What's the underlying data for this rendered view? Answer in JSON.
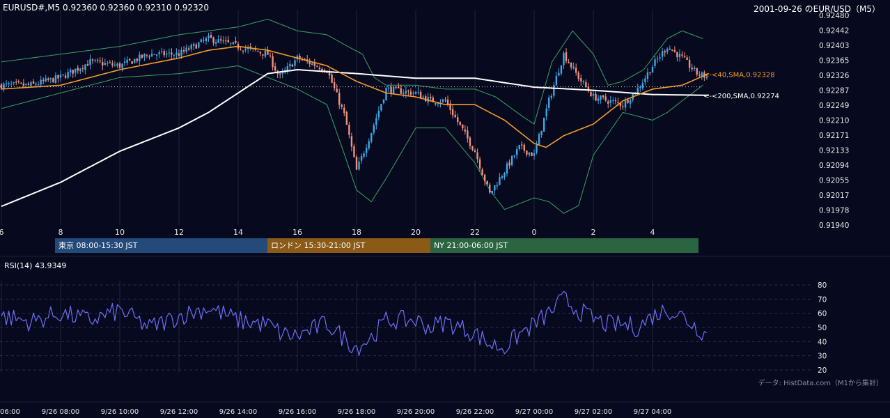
{
  "header": {
    "ohlc_text": "EURUSD#,M5 0.92360 0.92360 0.92310 0.92320",
    "title_date": "2001-09-26 のEUR/USD（M5）"
  },
  "sessions": [
    {
      "label": "東京 08:00-15:30 JST",
      "color": "#244a7a"
    },
    {
      "label": "ロンドン 15:30-21:00 JST",
      "color": "#8a5a16"
    },
    {
      "label": "NY 21:00-06:00 JST",
      "color": "#2a6440"
    }
  ],
  "rsi_panel": {
    "label": "RSI(14) 43.9349",
    "source_note": "データ: HistData.com（M1から集計）"
  },
  "colors": {
    "background": "#070a1f",
    "candle_up": "#3fa7e5",
    "candle_down": "#f2917b",
    "bollinger": "#3aa35f",
    "sma40": "#f39a2a",
    "sma200": "#ffffff",
    "rsi": "#6f6ff5",
    "grid": "#1f2438"
  },
  "chart_data": [
    {
      "type": "candlestick",
      "title": "EURUSD#,M5",
      "y_ticks": [
        "0.92480",
        "0.92442",
        "0.92403",
        "0.92365",
        "0.92326",
        "0.92287",
        "0.92249",
        "0.92210",
        "0.92171",
        "0.92133",
        "0.92094",
        "0.92055",
        "0.92017",
        "0.91978",
        "0.91940"
      ],
      "ylim": [
        0.9194,
        0.9248
      ],
      "x_ticks": [
        "6",
        "8",
        "10",
        "12",
        "14",
        "16",
        "18",
        "20",
        "22",
        "0",
        "2",
        "4"
      ],
      "xlim_hours": [
        6,
        29.9
      ],
      "last_close": 0.9232,
      "current_price_line": 0.92296,
      "series_control_points": {
        "close": [
          [
            6,
            0.923
          ],
          [
            7,
            0.923
          ],
          [
            8,
            0.9232
          ],
          [
            9,
            0.9236
          ],
          [
            10,
            0.9235
          ],
          [
            11,
            0.9238
          ],
          [
            12,
            0.9238
          ],
          [
            13,
            0.9242
          ],
          [
            14,
            0.924
          ],
          [
            15,
            0.9238
          ],
          [
            15.4,
            0.9232
          ],
          [
            16,
            0.9237
          ],
          [
            17,
            0.9234
          ],
          [
            17.6,
            0.9222
          ],
          [
            18,
            0.9208
          ],
          [
            18.5,
            0.9218
          ],
          [
            19,
            0.9229
          ],
          [
            20,
            0.9228
          ],
          [
            20.5,
            0.9226
          ],
          [
            21,
            0.9226
          ],
          [
            22,
            0.9213
          ],
          [
            22.5,
            0.9202
          ],
          [
            23,
            0.9208
          ],
          [
            23.5,
            0.9214
          ],
          [
            24,
            0.9212
          ],
          [
            24.5,
            0.9226
          ],
          [
            25,
            0.9238
          ],
          [
            25.5,
            0.9232
          ],
          [
            26,
            0.9227
          ],
          [
            26.5,
            0.9226
          ],
          [
            27,
            0.9225
          ],
          [
            27.5,
            0.9229
          ],
          [
            28,
            0.9235
          ],
          [
            28.5,
            0.924
          ],
          [
            29,
            0.9237
          ],
          [
            29.5,
            0.9233
          ],
          [
            29.9,
            0.9232
          ]
        ],
        "bb_upper": [
          [
            6,
            0.9236
          ],
          [
            8,
            0.9238
          ],
          [
            10,
            0.924
          ],
          [
            12,
            0.9243
          ],
          [
            14,
            0.9245
          ],
          [
            15,
            0.9247
          ],
          [
            16,
            0.9244
          ],
          [
            17,
            0.9243
          ],
          [
            17.7,
            0.924
          ],
          [
            18.2,
            0.9238
          ],
          [
            18.6,
            0.9232
          ],
          [
            19,
            0.923
          ],
          [
            20,
            0.923
          ],
          [
            21,
            0.9229
          ],
          [
            22,
            0.9229
          ],
          [
            22.7,
            0.9227
          ],
          [
            23.6,
            0.9222
          ],
          [
            24,
            0.922
          ],
          [
            24.6,
            0.9236
          ],
          [
            25.3,
            0.9244
          ],
          [
            26,
            0.9238
          ],
          [
            26.5,
            0.923
          ],
          [
            27,
            0.9231
          ],
          [
            27.7,
            0.9234
          ],
          [
            28.5,
            0.9242
          ],
          [
            29,
            0.9244
          ],
          [
            29.7,
            0.9242
          ]
        ],
        "bb_lower": [
          [
            6,
            0.9224
          ],
          [
            8,
            0.9228
          ],
          [
            10,
            0.9232
          ],
          [
            12,
            0.9233
          ],
          [
            14,
            0.9235
          ],
          [
            15,
            0.9232
          ],
          [
            16,
            0.9229
          ],
          [
            17,
            0.9225
          ],
          [
            17.6,
            0.9212
          ],
          [
            18,
            0.9203
          ],
          [
            18.5,
            0.92
          ],
          [
            19,
            0.9206
          ],
          [
            20,
            0.9219
          ],
          [
            21,
            0.9219
          ],
          [
            22,
            0.921
          ],
          [
            22.5,
            0.9203
          ],
          [
            23,
            0.9198
          ],
          [
            24,
            0.9201
          ],
          [
            24.5,
            0.92
          ],
          [
            25,
            0.9197
          ],
          [
            25.5,
            0.9199
          ],
          [
            26,
            0.9212
          ],
          [
            27,
            0.9223
          ],
          [
            28,
            0.9221
          ],
          [
            28.5,
            0.9223
          ],
          [
            29,
            0.9226
          ],
          [
            29.7,
            0.923
          ]
        ],
        "sma40": [
          [
            6,
            0.9229
          ],
          [
            8,
            0.923
          ],
          [
            10,
            0.9234
          ],
          [
            12,
            0.9237
          ],
          [
            13,
            0.9239
          ],
          [
            14,
            0.924
          ],
          [
            15,
            0.9239
          ],
          [
            16,
            0.9237
          ],
          [
            17,
            0.9235
          ],
          [
            18,
            0.9231
          ],
          [
            19,
            0.9228
          ],
          [
            20,
            0.9227
          ],
          [
            21,
            0.9225
          ],
          [
            22,
            0.9225
          ],
          [
            23,
            0.9221
          ],
          [
            24,
            0.9215
          ],
          [
            24.4,
            0.9214
          ],
          [
            25,
            0.9217
          ],
          [
            26,
            0.922
          ],
          [
            27,
            0.9226
          ],
          [
            28,
            0.9229
          ],
          [
            29,
            0.923
          ],
          [
            29.9,
            0.9233
          ]
        ],
        "sma200": [
          [
            6,
            0.91988
          ],
          [
            8,
            0.9205
          ],
          [
            10,
            0.9213
          ],
          [
            12,
            0.9219
          ],
          [
            13,
            0.9223
          ],
          [
            14,
            0.9228
          ],
          [
            15,
            0.9233
          ],
          [
            16,
            0.9234
          ],
          [
            18,
            0.9233
          ],
          [
            20,
            0.92318
          ],
          [
            22,
            0.92318
          ],
          [
            24,
            0.92295
          ],
          [
            26,
            0.92287
          ],
          [
            28,
            0.92276
          ],
          [
            29.9,
            0.92274
          ]
        ]
      },
      "annotations": [
        {
          "text": "<-<40,SMA,0.92328",
          "series": "sma40",
          "value": 0.92328
        },
        {
          "text": "<-<200,SMA,0.92274",
          "series": "sma200",
          "value": 0.92274
        }
      ]
    },
    {
      "type": "line",
      "title": "RSI(14) 43.9349",
      "y_ticks": [
        "80",
        "70",
        "60",
        "50",
        "40",
        "30",
        "20"
      ],
      "ylim": [
        20,
        80
      ],
      "x_tick_labels": [
        "06:00",
        "9/26 08:00",
        "9/26 10:00",
        "9/26 12:00",
        "9/26 14:00",
        "9/26 16:00",
        "9/26 18:00",
        "9/26 20:00",
        "9/26 22:00",
        "9/27 00:00",
        "9/27 02:00",
        "9/27 04:00"
      ],
      "last_value": 43.9349,
      "control_points": [
        [
          6,
          58
        ],
        [
          7,
          54
        ],
        [
          8,
          60
        ],
        [
          9,
          55
        ],
        [
          10,
          62
        ],
        [
          11,
          50
        ],
        [
          12,
          58
        ],
        [
          13,
          64
        ],
        [
          14,
          55
        ],
        [
          15,
          52
        ],
        [
          15.5,
          45
        ],
        [
          16,
          44
        ],
        [
          17,
          53
        ],
        [
          17.6,
          42
        ],
        [
          18,
          36
        ],
        [
          18.5,
          43
        ],
        [
          19,
          55
        ],
        [
          20,
          55
        ],
        [
          20.5,
          50
        ],
        [
          21,
          54
        ],
        [
          22,
          46
        ],
        [
          22.5,
          38
        ],
        [
          23,
          36
        ],
        [
          23.5,
          45
        ],
        [
          24,
          52
        ],
        [
          24.5,
          60
        ],
        [
          25,
          70
        ],
        [
          25.5,
          62
        ],
        [
          26,
          56
        ],
        [
          26.5,
          52
        ],
        [
          27,
          52
        ],
        [
          27.5,
          50
        ],
        [
          28,
          58
        ],
        [
          28.5,
          63
        ],
        [
          29,
          58
        ],
        [
          29.5,
          50
        ],
        [
          29.9,
          44
        ]
      ]
    }
  ]
}
